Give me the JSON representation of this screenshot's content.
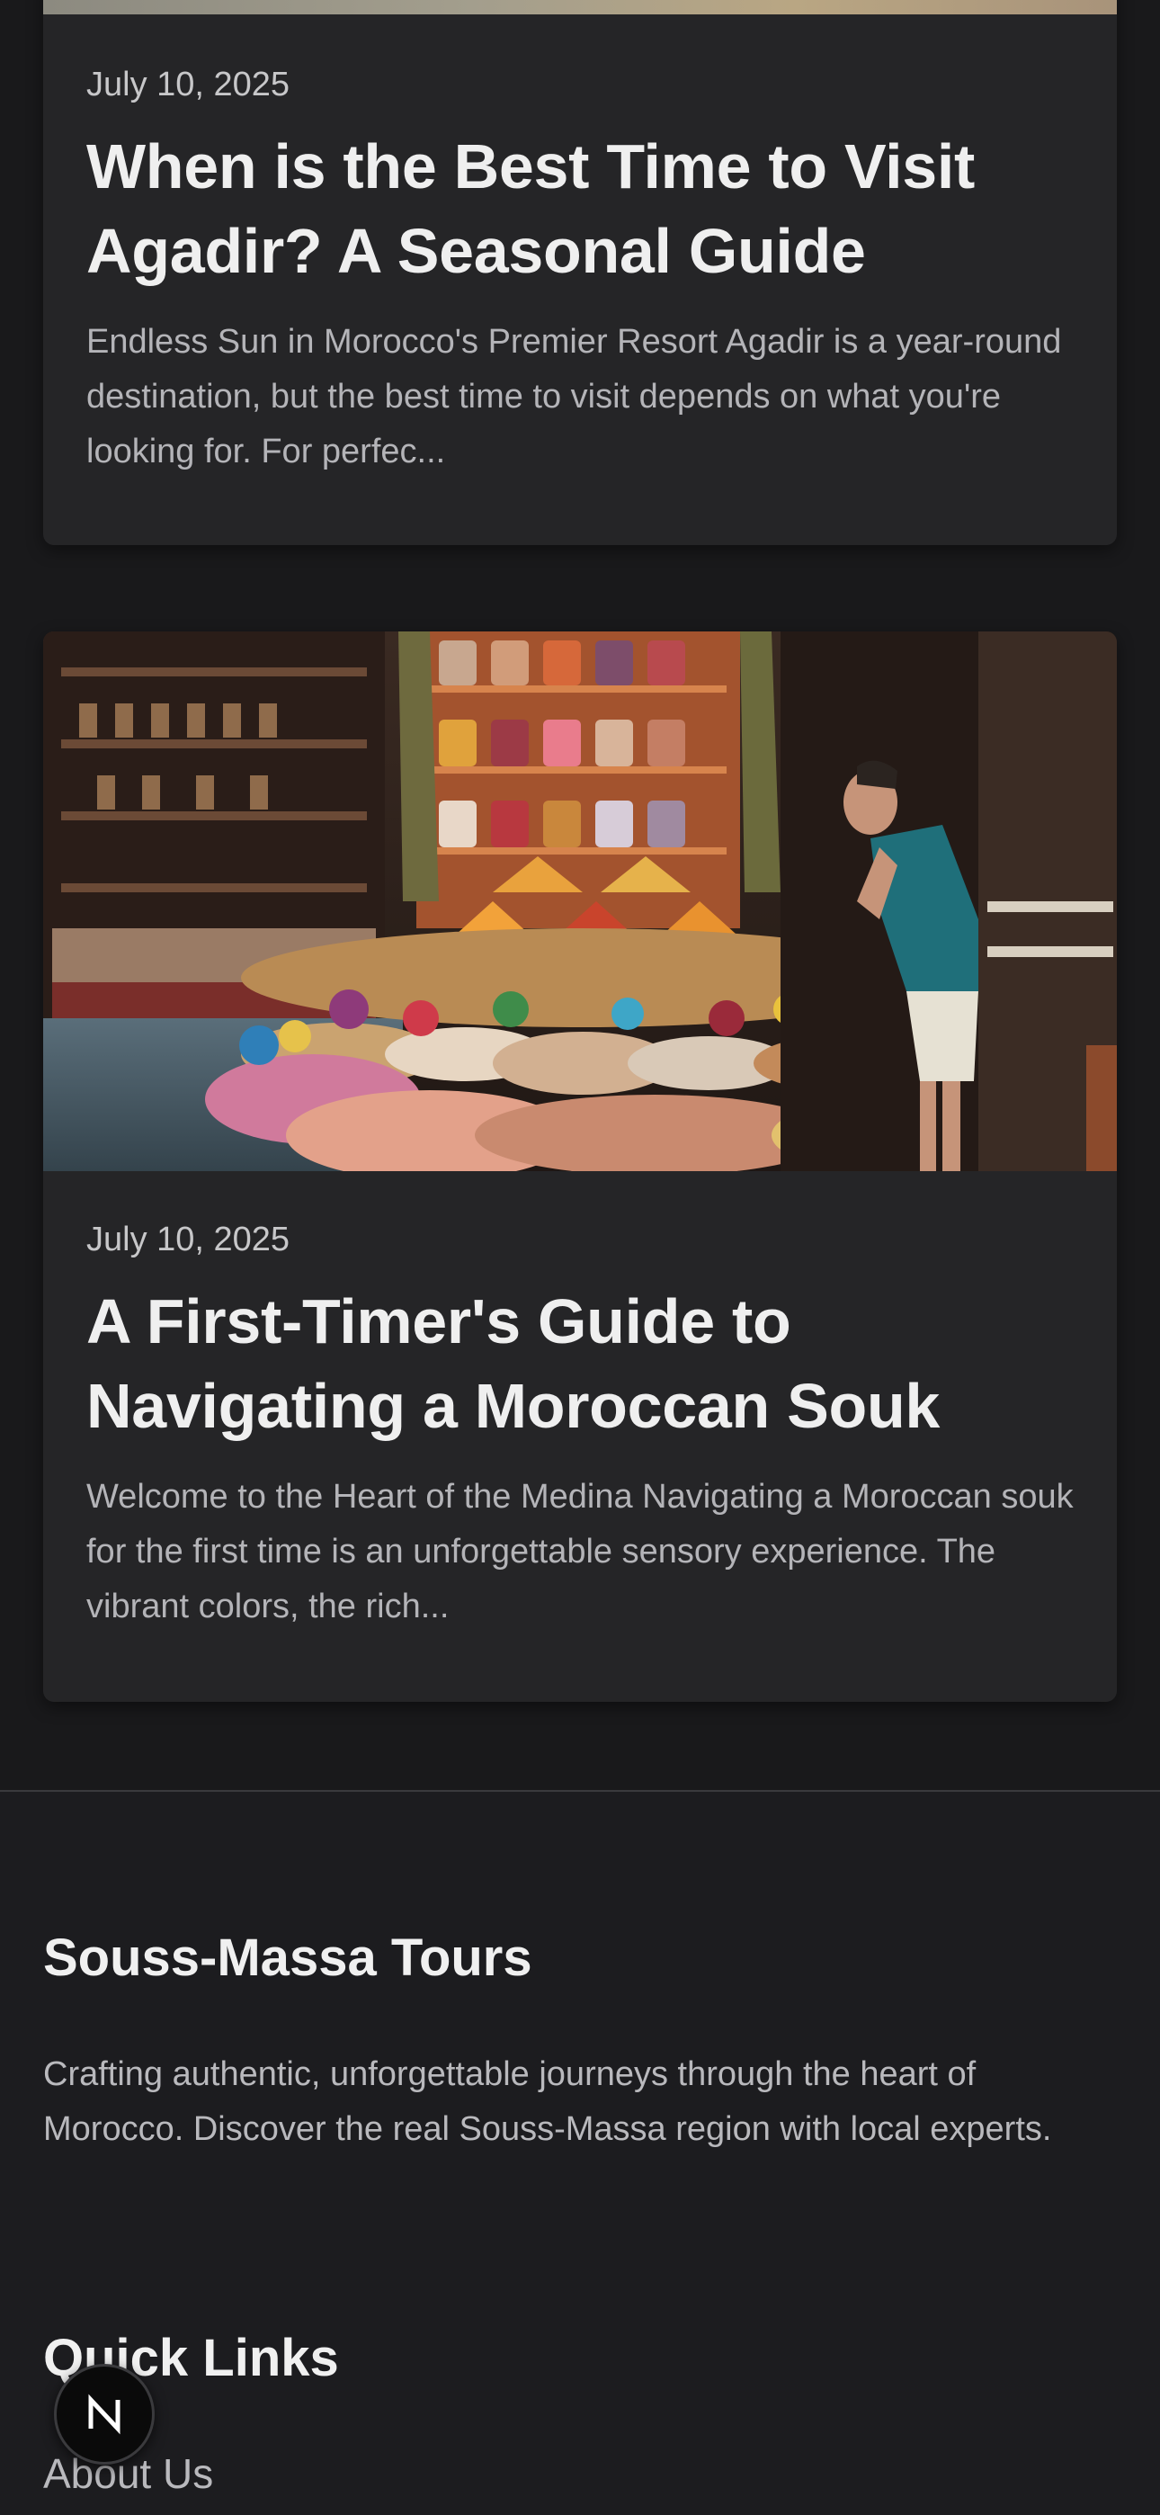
{
  "posts": [
    {
      "date": "July 10, 2025",
      "title": "When is the Best Time to Visit Agadir? A Seasonal Guide",
      "excerpt": "Endless Sun in Morocco's Premier Resort Agadir is a year-round destination, but the best time to visit depends on what you're looking for. For perfec..."
    },
    {
      "date": "July 10, 2025",
      "title": "A First-Timer's Guide to Navigating a Moroccan Souk",
      "excerpt": "Welcome to the Heart of the Medina Navigating a Moroccan souk for the first time is an unforgettable sensory experience. The vibrant colors, the rich..."
    }
  ],
  "footer": {
    "brand": "Souss-Massa Tours",
    "tagline": "Crafting authentic, unforgettable journeys through the heart of Morocco. Discover the real Souss-Massa region with local experts.",
    "quick_links_title": "Quick Links",
    "links": [
      "About Us"
    ]
  },
  "next_badge": {
    "icon": "nextjs-n-icon",
    "letter": "N"
  },
  "colors": {
    "page_bg": "#19191b",
    "card_bg": "#252527",
    "title_text": "#efefef",
    "body_text": "#b4b4b8"
  }
}
